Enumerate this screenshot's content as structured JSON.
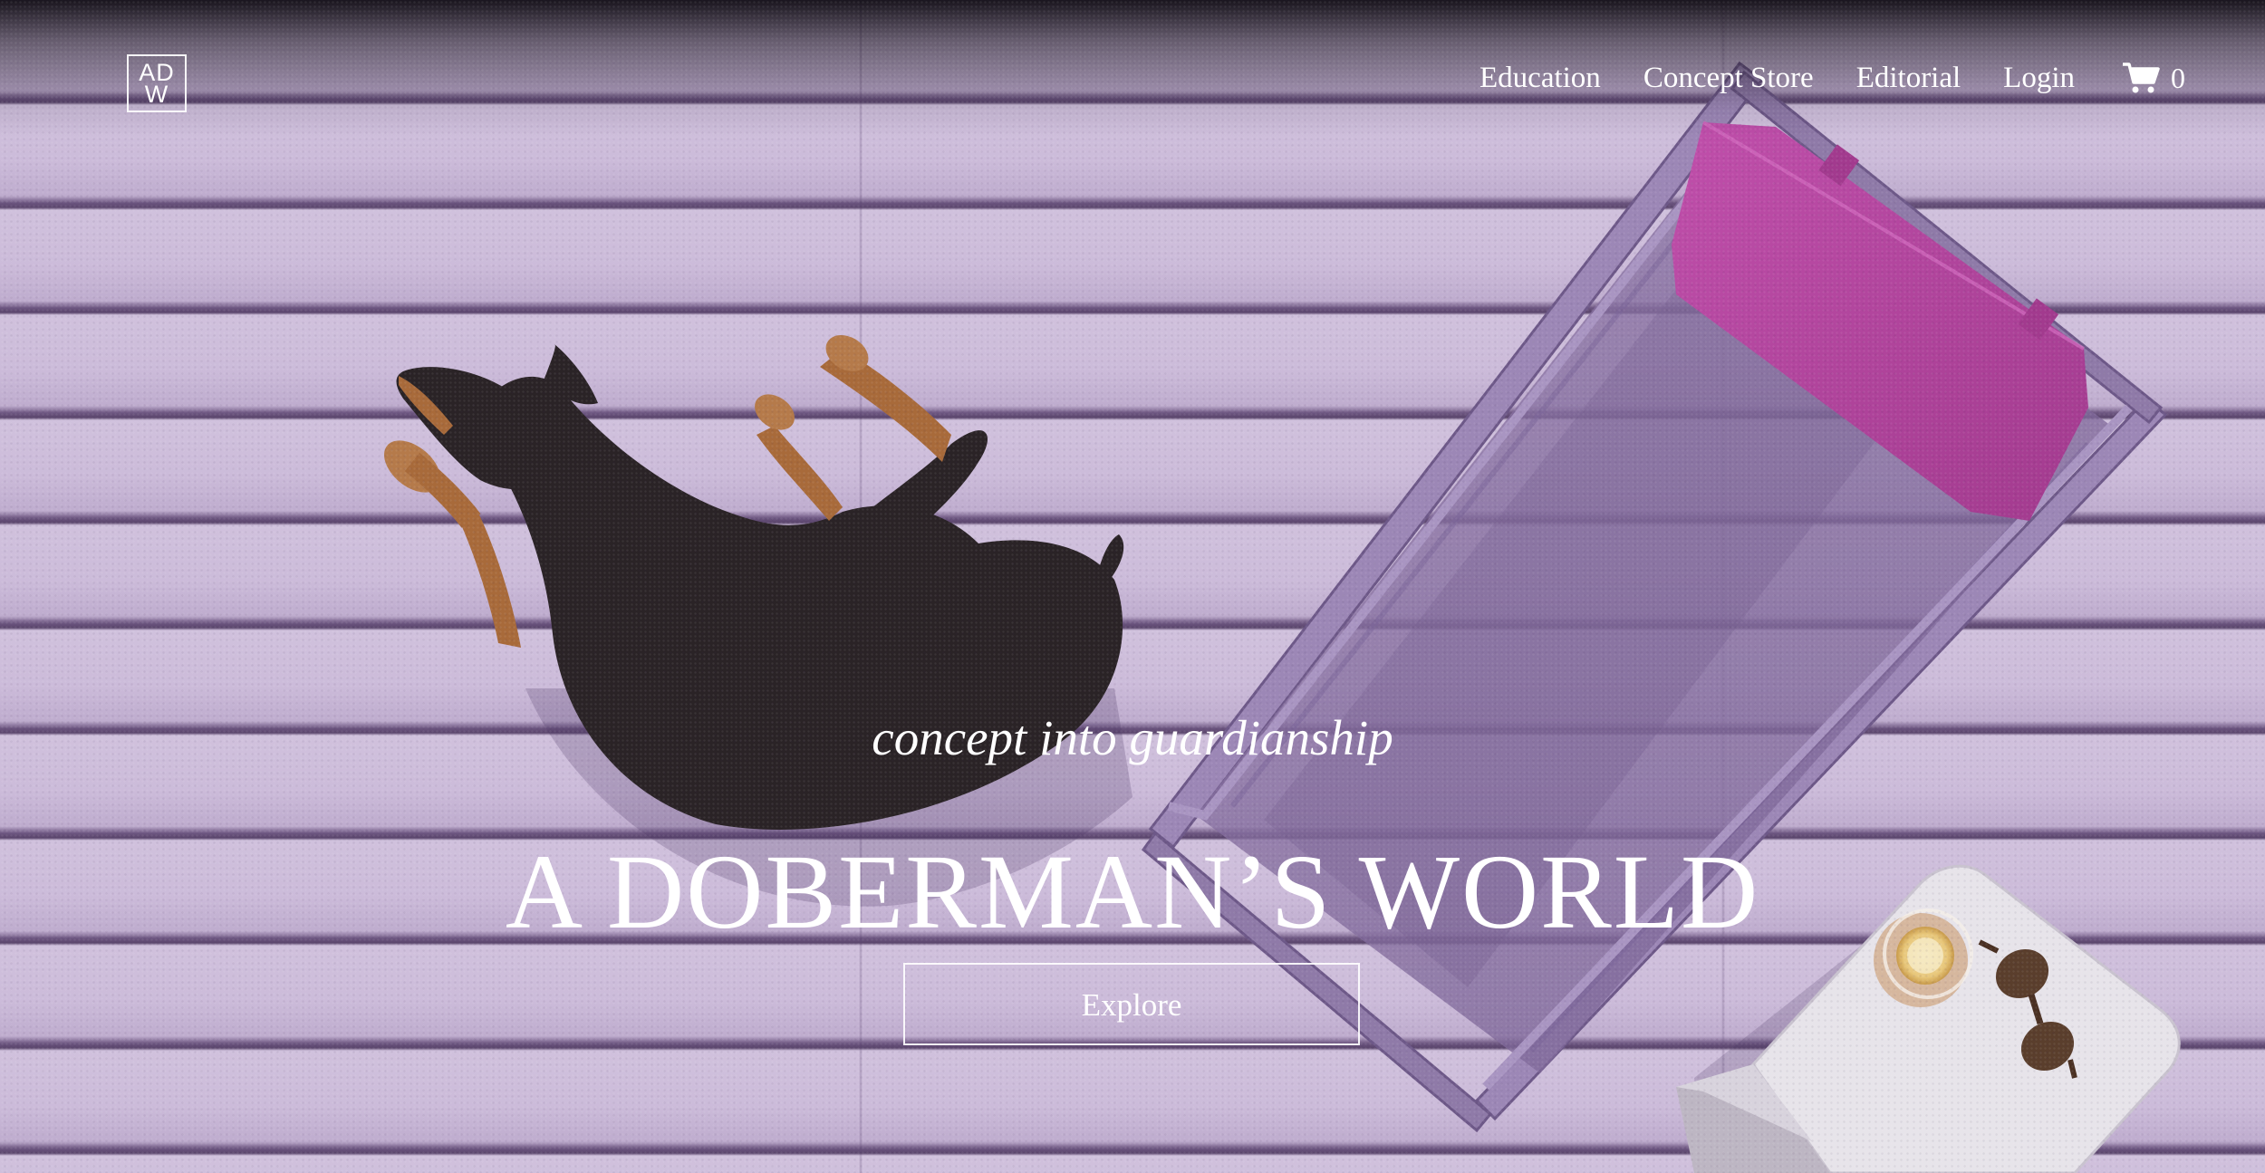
{
  "brand": {
    "logo_line1": "AD",
    "logo_line2": "W"
  },
  "nav": {
    "items": [
      {
        "label": "Education"
      },
      {
        "label": "Concept Store"
      },
      {
        "label": "Editorial"
      },
      {
        "label": "Login"
      }
    ],
    "cart_icon": "shopping-cart-icon",
    "cart_count": "0"
  },
  "hero": {
    "tagline": "concept into guardianship",
    "headline": "A DOBERMAN’S WORLD",
    "cta_label": "Explore",
    "scene": [
      "doberman-dog",
      "purple-deck-chair",
      "side-table",
      "drink-glass",
      "sunglasses"
    ]
  },
  "colors": {
    "deck": "#cbbad9",
    "cushion": "#b2449d",
    "text": "#ffffff"
  }
}
